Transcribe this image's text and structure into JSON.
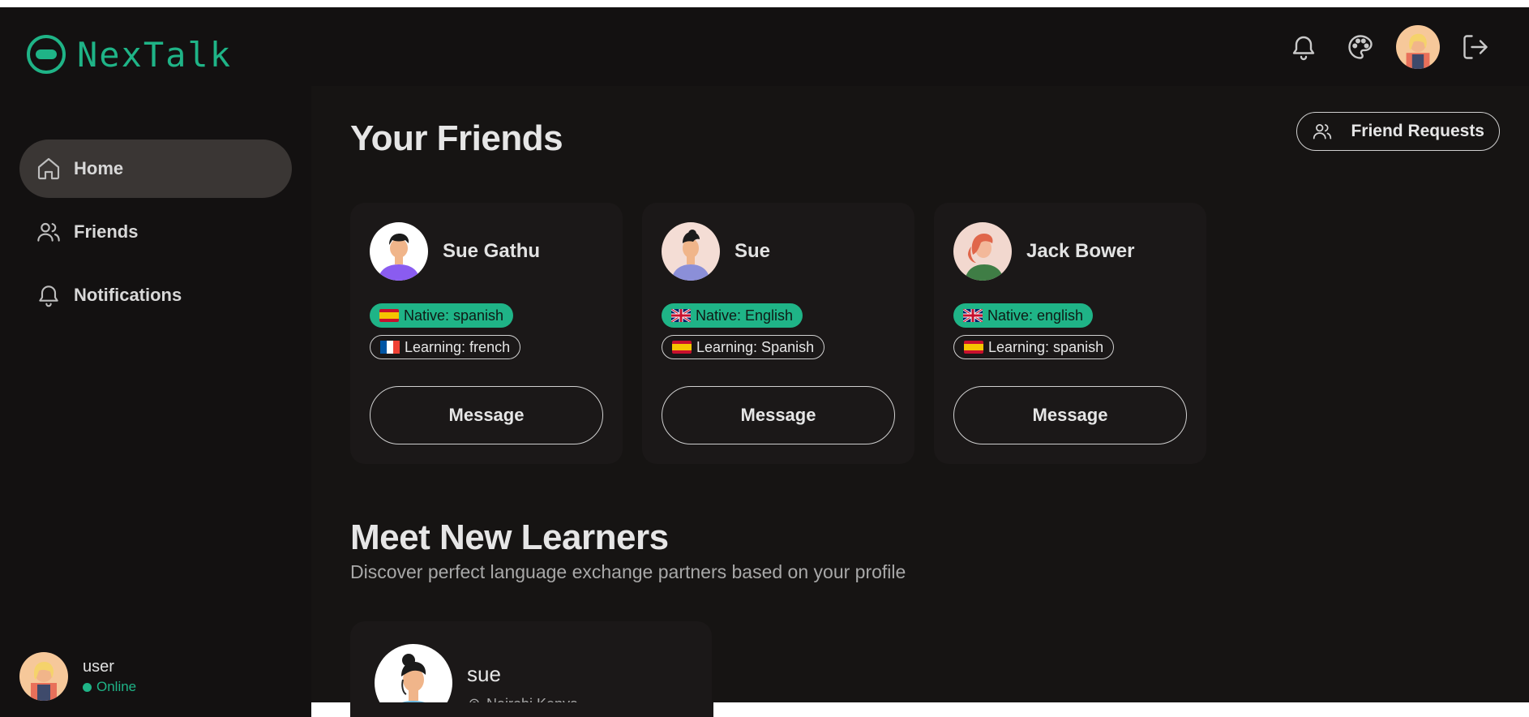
{
  "app": {
    "name": "NexTalk",
    "brand_color": "#1fb487"
  },
  "sidebar": {
    "items": [
      {
        "label": "Home",
        "icon": "home-icon",
        "active": true
      },
      {
        "label": "Friends",
        "icon": "users-icon",
        "active": false
      },
      {
        "label": "Notifications",
        "icon": "bell-icon",
        "active": false
      }
    ],
    "user": {
      "name": "user",
      "status": "Online"
    }
  },
  "header": {
    "icons": [
      "bell-icon",
      "palette-icon",
      "avatar",
      "logout-icon"
    ]
  },
  "main": {
    "friends_title": "Your Friends",
    "friend_requests_label": "Friend Requests",
    "friends": [
      {
        "name": "Sue Gathu",
        "native": "Native: spanish",
        "native_flag": "spain-flag",
        "learning": "Learning: french",
        "learning_flag": "france-flag",
        "button": "Message"
      },
      {
        "name": "Sue",
        "native": "Native: English",
        "native_flag": "uk-flag",
        "learning": "Learning: Spanish",
        "learning_flag": "spain-flag",
        "button": "Message"
      },
      {
        "name": "Jack Bower",
        "native": "Native: english",
        "native_flag": "uk-flag",
        "learning": "Learning: spanish",
        "learning_flag": "spain-flag",
        "button": "Message"
      }
    ],
    "learners_title": "Meet New Learners",
    "learners_subtitle": "Discover perfect language exchange partners based on your profile",
    "learners": [
      {
        "name": "sue",
        "location": "Nairobi,Kenya"
      }
    ]
  }
}
